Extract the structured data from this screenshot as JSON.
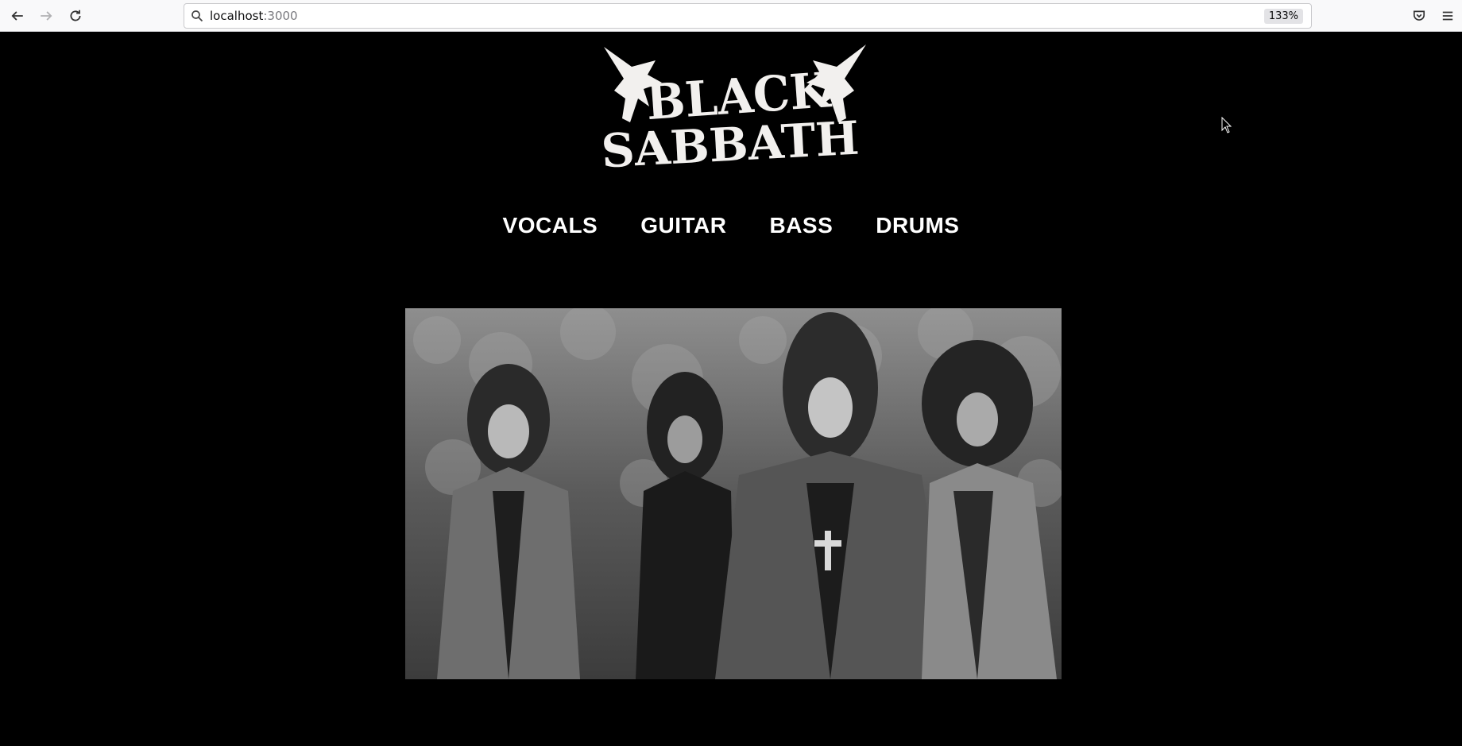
{
  "browser": {
    "url_host": "localhost",
    "url_port": ":3000",
    "zoom": "133%",
    "icons": [
      "back-arrow-icon",
      "forward-arrow-icon",
      "reload-icon",
      "search-icon",
      "pocket-icon",
      "hamburger-menu-icon"
    ]
  },
  "page": {
    "logo_text": "BLACK SABBATH",
    "nav": [
      {
        "label": "VOCALS"
      },
      {
        "label": "GUITAR"
      },
      {
        "label": "BASS"
      },
      {
        "label": "DRUMS"
      }
    ],
    "photo": "band-photo"
  },
  "colors": {
    "background": "#000000",
    "nav_text": "#ffffff",
    "toolbar": "#f9f9fa"
  }
}
